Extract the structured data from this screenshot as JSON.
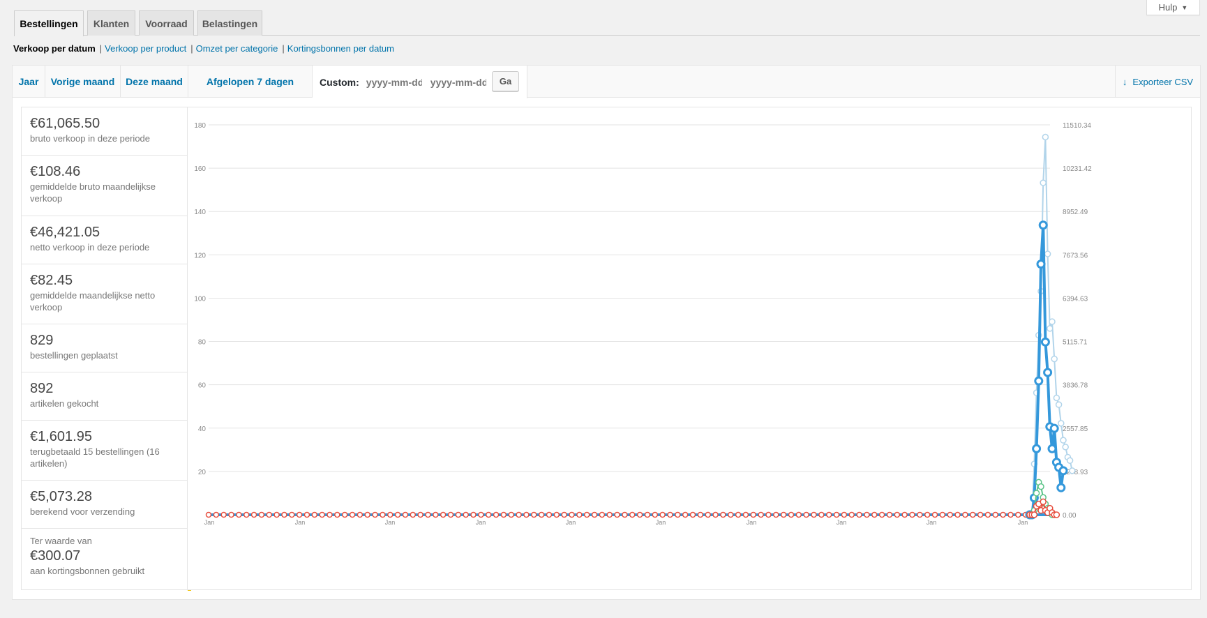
{
  "help": {
    "label": "Hulp",
    "caret": "▼"
  },
  "tabs": [
    "Bestellingen",
    "Klanten",
    "Voorraad",
    "Belastingen"
  ],
  "subnav": {
    "current": "Verkoop per datum",
    "sep": "|",
    "links": [
      "Verkoop per product",
      "Omzet per categorie",
      "Kortingsbonnen per datum"
    ]
  },
  "range": {
    "tabs": [
      "Jaar",
      "Vorige maand",
      "Deze maand",
      "Afgelopen 7 dagen"
    ],
    "custom_label": "Custom:",
    "from_placeholder": "yyyy-mm-dd",
    "to_placeholder": "yyyy-mm-dd",
    "go_label": "Ga",
    "export_label": "Exporteer CSV",
    "export_icon": "↓"
  },
  "legend": [
    {
      "value": "€61,065.50",
      "label": "bruto verkoop in deze periode",
      "color": "#b1d4ea"
    },
    {
      "value": "€108.46",
      "label": "gemiddelde bruto maandelijkse verkoop",
      "color": "#b1d4ea"
    },
    {
      "value": "€46,421.05",
      "label": "netto verkoop in deze periode",
      "color": "#3498db"
    },
    {
      "value": "€82.45",
      "label": "gemiddelde maandelijkse netto verkoop",
      "color": "#3498db"
    },
    {
      "value": "829",
      "label": "bestellingen geplaatst",
      "color": "#dbe1e3"
    },
    {
      "value": "892",
      "label": "artikelen gekocht",
      "color": "#ecf0f1"
    },
    {
      "value": "€1,601.95",
      "label": "terugbetaald 15 bestellingen (16 artikelen)",
      "color": "#e74c3c"
    },
    {
      "value": "€5,073.28",
      "label": "berekend voor verzending",
      "color": "#5cc488"
    },
    {
      "pre": "Ter waarde van",
      "value": "€300.07",
      "label": "aan kortingsbonnen gebruikt",
      "color": "#f1c40f"
    }
  ],
  "chart_data": {
    "type": "line",
    "left_axis": {
      "ticks": [
        0,
        20,
        40,
        60,
        80,
        100,
        120,
        140,
        160,
        180
      ],
      "range": [
        0,
        180
      ]
    },
    "right_axis": {
      "ticks": [
        "0.00",
        "1278.93",
        "2557.85",
        "3836.78",
        "5115.71",
        "6394.63",
        "7673.56",
        "8952.49",
        "10231.42",
        "11510.34"
      ],
      "range": [
        0,
        11510.34
      ]
    },
    "x_tick_labels": [
      "Jan",
      "Jan",
      "Jan",
      "Jan",
      "Jan",
      "Jan",
      "Jan",
      "Jan",
      "Jan",
      "Jan"
    ],
    "baseline_points": 110,
    "series": [
      {
        "color": "#b1d4ea",
        "axis": "right",
        "values": [
          0,
          0,
          1500,
          3600,
          5300,
          6600,
          9800,
          11150,
          7700,
          5500,
          5700,
          4600,
          3450,
          3250,
          2700,
          2200,
          2000,
          1700,
          1600,
          1300
        ]
      },
      {
        "color": "#3498db",
        "axis": "right",
        "values": [
          0,
          0,
          500,
          1950,
          3950,
          7400,
          8550,
          5100,
          4200,
          2600,
          1950,
          2550,
          1550,
          1400,
          800,
          1300
        ]
      },
      {
        "color": "#5cc488",
        "axis": "left",
        "values": [
          0,
          0,
          2,
          10,
          15,
          13,
          8,
          5,
          3,
          1,
          0
        ]
      },
      {
        "color": "#e74c3c",
        "axis": "left",
        "values": [
          0,
          0,
          0,
          4,
          5,
          2,
          6,
          2,
          1,
          3,
          1,
          0,
          0
        ]
      }
    ]
  }
}
